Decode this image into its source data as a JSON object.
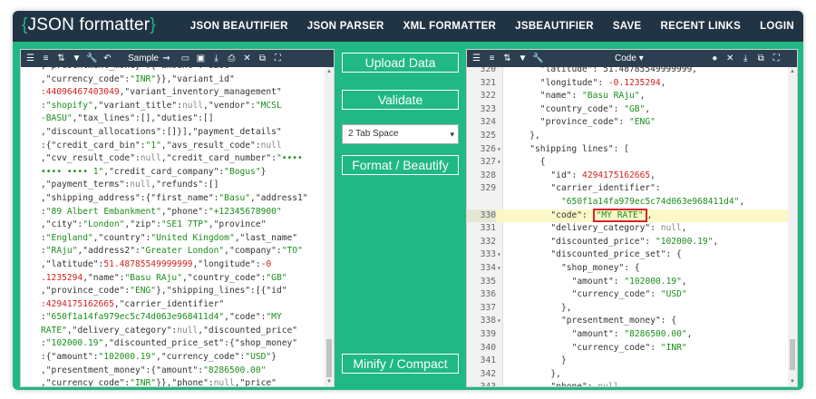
{
  "header": {
    "logo": "JSON formatter",
    "logo_open": "{",
    "logo_close": "}",
    "nav": [
      "JSON BEAUTIFIER",
      "JSON PARSER",
      "XML FORMATTER",
      "JSBEAUTIFIER",
      "SAVE",
      "RECENT LINKS",
      "LOGIN"
    ]
  },
  "left_toolbar": {
    "sample_label": "Sample",
    "icons": [
      "indent-icon",
      "align-icon",
      "sort-icon",
      "filter-icon",
      "wrench-icon",
      "undo-icon",
      "route-icon",
      "folder-icon",
      "save-icon",
      "download-icon",
      "print-icon",
      "close-icon",
      "copy-icon",
      "fullscreen-icon"
    ]
  },
  "middle": {
    "upload_label": "Upload Data",
    "validate_label": "Validate",
    "tab_space_value": "2 Tab Space",
    "format_label": "Format / Beautify",
    "minify_label": "Minify / Compact"
  },
  "right_toolbar": {
    "mode_label": "Code",
    "icons": [
      "indent-icon",
      "align-icon",
      "sort-icon",
      "filter-icon",
      "wrench-icon",
      "pin-icon",
      "close-icon",
      "download-icon",
      "copy-icon",
      "fullscreen-icon"
    ]
  },
  "left_lines": [
    [
      [
        "k",
        ",\"presentment_money\":{\"amount\":\"8286\""
      ]
    ],
    [
      [
        "k",
        ",\"currency_code\":"
      ],
      [
        "s",
        "\"INR\""
      ],
      [
        "k",
        "}},\"variant_id\""
      ]
    ],
    [
      [
        "n",
        ":44096467403049"
      ],
      [
        "k",
        ",\"variant_inventory_management\""
      ]
    ],
    [
      [
        "k",
        ":"
      ],
      [
        "s",
        "\"shopify\""
      ],
      [
        "k",
        ",\"variant_title\":"
      ],
      [
        "g",
        "null"
      ],
      [
        "k",
        ",\"vendor\":"
      ],
      [
        "s",
        "\"MCSL"
      ]
    ],
    [
      [
        "s",
        "-BASU\""
      ],
      [
        "k",
        ",\"tax_lines\":[],\"duties\":[]"
      ]
    ],
    [
      [
        "k",
        ",\"discount_allocations\":[]}],\"payment_details\""
      ]
    ],
    [
      [
        "k",
        ":{\"credit_card_bin\":"
      ],
      [
        "s",
        "\"1\""
      ],
      [
        "k",
        ",\"avs_result_code\":"
      ],
      [
        "g",
        "null"
      ]
    ],
    [
      [
        "k",
        ",\"cvv_result_code\":"
      ],
      [
        "g",
        "null"
      ],
      [
        "k",
        ",\"credit_card_number\":"
      ],
      [
        "s",
        "\"••••"
      ]
    ],
    [
      [
        "s",
        "•••• •••• 1\""
      ],
      [
        "k",
        ",\"credit_card_company\":"
      ],
      [
        "s",
        "\"Bogus\""
      ],
      [
        "k",
        "}"
      ]
    ],
    [
      [
        "k",
        ",\"payment_terms\":"
      ],
      [
        "g",
        "null"
      ],
      [
        "k",
        ",\"refunds\":[]"
      ]
    ],
    [
      [
        "k",
        ",\"shipping_address\":{\"first_name\":"
      ],
      [
        "s",
        "\"Basu\""
      ],
      [
        "k",
        ",\"address1\""
      ]
    ],
    [
      [
        "k",
        ":"
      ],
      [
        "s",
        "\"89 Albert Embankment\""
      ],
      [
        "k",
        ",\"phone\":"
      ],
      [
        "s",
        "\"+12345678900\""
      ]
    ],
    [
      [
        "k",
        ",\"city\":"
      ],
      [
        "s",
        "\"London\""
      ],
      [
        "k",
        ",\"zip\":"
      ],
      [
        "s",
        "\"SE1 7TP\""
      ],
      [
        "k",
        ",\"province\""
      ]
    ],
    [
      [
        "k",
        ":"
      ],
      [
        "s",
        "\"England\""
      ],
      [
        "k",
        ",\"country\":"
      ],
      [
        "s",
        "\"United Kingdom\""
      ],
      [
        "k",
        ",\"last_name\""
      ]
    ],
    [
      [
        "k",
        ":"
      ],
      [
        "s",
        "\"RAju\""
      ],
      [
        "k",
        ",\"address2\":"
      ],
      [
        "s",
        "\"Greater London\""
      ],
      [
        "k",
        ",\"company\":"
      ],
      [
        "s",
        "\"TO\""
      ]
    ],
    [
      [
        "k",
        ",\"latitude\":"
      ],
      [
        "n",
        "51.48785549999999"
      ],
      [
        "k",
        ",\"longitude\":"
      ],
      [
        "n",
        "-0"
      ]
    ],
    [
      [
        "n",
        ".1235294"
      ],
      [
        "k",
        ",\"name\":"
      ],
      [
        "s",
        "\"Basu RAju\""
      ],
      [
        "k",
        ",\"country_code\":"
      ],
      [
        "s",
        "\"GB\""
      ]
    ],
    [
      [
        "k",
        ",\"province_code\":"
      ],
      [
        "s",
        "\"ENG\""
      ],
      [
        "k",
        "},\"shipping_lines\":[{\"id\""
      ]
    ],
    [
      [
        "n",
        ":4294175162665"
      ],
      [
        "k",
        ",\"carrier_identifier\""
      ]
    ],
    [
      [
        "k",
        ":"
      ],
      [
        "s",
        "\"650f1a14fa979ec5c74d063e968411d4\""
      ],
      [
        "k",
        ",\"code\":"
      ],
      [
        "s",
        "\"MY"
      ]
    ],
    [
      [
        "s",
        "RATE\""
      ],
      [
        "k",
        ",\"delivery_category\":"
      ],
      [
        "g",
        "null"
      ],
      [
        "k",
        ",\"discounted_price\""
      ]
    ],
    [
      [
        "k",
        ":"
      ],
      [
        "s",
        "\"102000.19\""
      ],
      [
        "k",
        ",\"discounted_price_set\":{\"shop_money\""
      ]
    ],
    [
      [
        "k",
        ":{\"amount\":"
      ],
      [
        "s",
        "\"102000.19\""
      ],
      [
        "k",
        ",\"currency_code\":"
      ],
      [
        "s",
        "\"USD\""
      ],
      [
        "k",
        "}"
      ]
    ],
    [
      [
        "k",
        ",\"presentment_money\":{\"amount\":"
      ],
      [
        "s",
        "\"8286500.00\""
      ]
    ],
    [
      [
        "k",
        ",\"currency_code\":"
      ],
      [
        "s",
        "\"INR\""
      ],
      [
        "k",
        "}},\"phone\":"
      ],
      [
        "g",
        "null"
      ],
      [
        "k",
        ",\"price\""
      ]
    ]
  ],
  "right_lines": [
    {
      "num": "320",
      "fold": "",
      "indent": 6,
      "parts": [
        [
          "k",
          "\"latitude\": 51.48785549999999,"
        ]
      ]
    },
    {
      "num": "321",
      "fold": "",
      "indent": 6,
      "parts": [
        [
          "k",
          "\"longitude\": "
        ],
        [
          "n",
          "-0.1235294"
        ],
        [
          "k",
          ","
        ]
      ]
    },
    {
      "num": "322",
      "fold": "",
      "indent": 6,
      "parts": [
        [
          "k",
          "\"name\": "
        ],
        [
          "s",
          "\"Basu RAju\""
        ],
        [
          "k",
          ","
        ]
      ]
    },
    {
      "num": "323",
      "fold": "",
      "indent": 6,
      "parts": [
        [
          "k",
          "\"country_code\": "
        ],
        [
          "s",
          "\"GB\""
        ],
        [
          "k",
          ","
        ]
      ]
    },
    {
      "num": "324",
      "fold": "",
      "indent": 6,
      "parts": [
        [
          "k",
          "\"province_code\": "
        ],
        [
          "s",
          "\"ENG\""
        ]
      ]
    },
    {
      "num": "325",
      "fold": "",
      "indent": 4,
      "parts": [
        [
          "k",
          "},"
        ]
      ]
    },
    {
      "num": "326",
      "fold": "▾",
      "indent": 4,
      "parts": [
        [
          "k",
          "\"shipping lines\": ["
        ]
      ]
    },
    {
      "num": "327",
      "fold": "▾",
      "indent": 6,
      "parts": [
        [
          "k",
          "{"
        ]
      ]
    },
    {
      "num": "328",
      "fold": "",
      "indent": 8,
      "parts": [
        [
          "k",
          "\"id\": "
        ],
        [
          "n",
          "4294175162665"
        ],
        [
          "k",
          ","
        ]
      ]
    },
    {
      "num": "329",
      "fold": "",
      "indent": 8,
      "parts": [
        [
          "k",
          "\"carrier_identifier\":"
        ]
      ]
    },
    {
      "num": "",
      "fold": "",
      "indent": 10,
      "parts": [
        [
          "s",
          "\"650f1a14fa979ec5c74d063e968411d4\""
        ],
        [
          "k",
          ","
        ]
      ]
    },
    {
      "num": "330",
      "fold": "",
      "indent": 8,
      "parts": [
        [
          "k",
          "\"code\": "
        ],
        [
          "s",
          "\"MY RATE\""
        ],
        [
          "k",
          ","
        ]
      ],
      "active": true
    },
    {
      "num": "331",
      "fold": "",
      "indent": 8,
      "parts": [
        [
          "k",
          "\"delivery_category\": "
        ],
        [
          "g",
          "null"
        ],
        [
          "k",
          ","
        ]
      ]
    },
    {
      "num": "332",
      "fold": "",
      "indent": 8,
      "parts": [
        [
          "k",
          "\"discounted_price\": "
        ],
        [
          "s",
          "\"102000.19\""
        ],
        [
          "k",
          ","
        ]
      ]
    },
    {
      "num": "333",
      "fold": "▾",
      "indent": 8,
      "parts": [
        [
          "k",
          "\"discounted_price_set\": {"
        ]
      ]
    },
    {
      "num": "334",
      "fold": "▾",
      "indent": 10,
      "parts": [
        [
          "k",
          "\"shop_money\": {"
        ]
      ]
    },
    {
      "num": "335",
      "fold": "",
      "indent": 12,
      "parts": [
        [
          "k",
          "\"amount\": "
        ],
        [
          "s",
          "\"102000.19\""
        ],
        [
          "k",
          ","
        ]
      ]
    },
    {
      "num": "336",
      "fold": "",
      "indent": 12,
      "parts": [
        [
          "k",
          "\"currency_code\": "
        ],
        [
          "s",
          "\"USD\""
        ]
      ]
    },
    {
      "num": "337",
      "fold": "",
      "indent": 10,
      "parts": [
        [
          "k",
          "},"
        ]
      ]
    },
    {
      "num": "338",
      "fold": "▾",
      "indent": 10,
      "parts": [
        [
          "k",
          "\"presentment_money\": {"
        ]
      ]
    },
    {
      "num": "339",
      "fold": "",
      "indent": 12,
      "parts": [
        [
          "k",
          "\"amount\": "
        ],
        [
          "s",
          "\"8286500.00\""
        ],
        [
          "k",
          ","
        ]
      ]
    },
    {
      "num": "340",
      "fold": "",
      "indent": 12,
      "parts": [
        [
          "k",
          "\"currency_code\": "
        ],
        [
          "s",
          "\"INR\""
        ]
      ]
    },
    {
      "num": "341",
      "fold": "",
      "indent": 10,
      "parts": [
        [
          "k",
          "}"
        ]
      ]
    },
    {
      "num": "342",
      "fold": "",
      "indent": 8,
      "parts": [
        [
          "k",
          "},"
        ]
      ]
    },
    {
      "num": "343",
      "fold": "",
      "indent": 8,
      "parts": [
        [
          "k",
          "\"phone\": "
        ],
        [
          "g",
          "null"
        ],
        [
          "k",
          ","
        ]
      ]
    }
  ],
  "colors": {
    "accent_green": "#20b884",
    "header_dark": "#213445",
    "toolbar_dark": "#2c3e4f",
    "string_green": "#1a8f1a",
    "number_red": "#d61f1f",
    "active_line": "#fbf8c8",
    "highlight_box": "#dd2222"
  }
}
